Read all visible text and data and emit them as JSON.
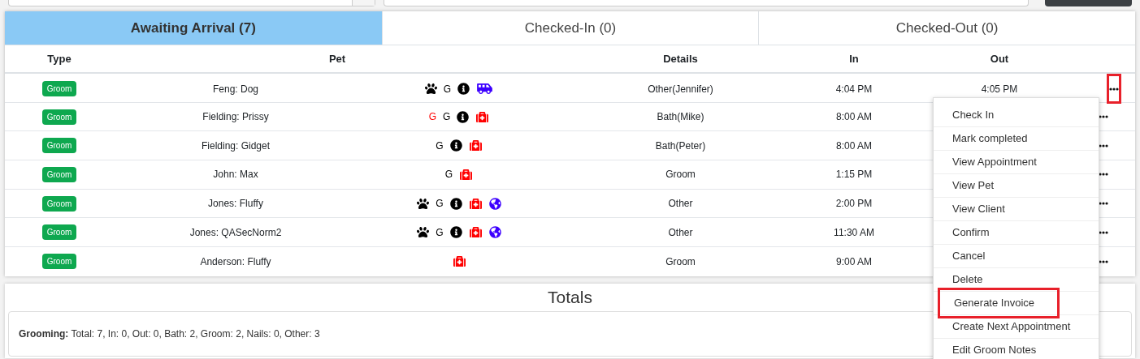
{
  "tabs": [
    {
      "label": "Awaiting Arrival (7)",
      "selected": true
    },
    {
      "label": "Checked-In (0)",
      "selected": false
    },
    {
      "label": "Checked-Out (0)",
      "selected": false
    }
  ],
  "table": {
    "columns": [
      "Type",
      "Pet",
      "Details",
      "In",
      "Out"
    ],
    "rows": [
      {
        "type": "Groom",
        "pet": "Feng: Dog",
        "flags": [
          {
            "kind": "paw"
          },
          {
            "kind": "letter",
            "text": "G",
            "color": "#000000"
          },
          {
            "kind": "info"
          },
          {
            "kind": "van"
          }
        ],
        "details": "Other(Jennifer)",
        "in": "4:04 PM",
        "out": "4:05 PM",
        "actions_highlighted": true
      },
      {
        "type": "Groom",
        "pet": "Fielding: Prissy",
        "flags": [
          {
            "kind": "letter",
            "text": "G",
            "color": "#ff0000"
          },
          {
            "kind": "letter",
            "text": "G",
            "color": "#000000"
          },
          {
            "kind": "info"
          },
          {
            "kind": "medkit"
          }
        ],
        "details": "Bath(Mike)",
        "in": "8:00 AM",
        "out": "",
        "actions_highlighted": false
      },
      {
        "type": "Groom",
        "pet": "Fielding: Gidget",
        "flags": [
          {
            "kind": "letter",
            "text": "G",
            "color": "#000000"
          },
          {
            "kind": "info"
          },
          {
            "kind": "medkit"
          }
        ],
        "details": "Bath(Peter)",
        "in": "8:00 AM",
        "actions_highlighted": false
      },
      {
        "type": "Groom",
        "pet": "John: Max",
        "flags": [
          {
            "kind": "letter",
            "text": "G",
            "color": "#000000"
          },
          {
            "kind": "medkit"
          }
        ],
        "details": "Groom",
        "in": "1:15 PM",
        "actions_highlighted": false
      },
      {
        "type": "Groom",
        "pet": "Jones: Fluffy",
        "flags": [
          {
            "kind": "paw"
          },
          {
            "kind": "letter",
            "text": "G",
            "color": "#000000"
          },
          {
            "kind": "info"
          },
          {
            "kind": "medkit"
          },
          {
            "kind": "globe"
          }
        ],
        "details": "Other",
        "in": "2:00 PM",
        "actions_highlighted": false
      },
      {
        "type": "Groom",
        "pet": "Jones: QASecNorm2",
        "flags": [
          {
            "kind": "paw"
          },
          {
            "kind": "letter",
            "text": "G",
            "color": "#000000"
          },
          {
            "kind": "info"
          },
          {
            "kind": "medkit"
          },
          {
            "kind": "globe"
          }
        ],
        "details": "Other",
        "in": "11:30 AM",
        "actions_highlighted": false
      },
      {
        "type": "Groom",
        "pet": "Anderson: Fluffy",
        "flags": [
          {
            "kind": "medkit"
          }
        ],
        "details": "Groom",
        "in": "9:00 AM",
        "actions_highlighted": false
      }
    ]
  },
  "menu": {
    "items": [
      {
        "label": "Check In",
        "highlighted": false
      },
      {
        "label": "Mark completed",
        "highlighted": false
      },
      {
        "label": "View Appointment",
        "highlighted": false
      },
      {
        "label": "View Pet",
        "highlighted": false
      },
      {
        "label": "View Client",
        "highlighted": false
      },
      {
        "label": "Confirm",
        "highlighted": false
      },
      {
        "label": "Cancel",
        "highlighted": false
      },
      {
        "label": "Delete",
        "highlighted": false
      },
      {
        "label": "Generate Invoice",
        "highlighted": true
      },
      {
        "label": "Create Next Appointment",
        "highlighted": false
      },
      {
        "label": "Edit Groom Notes",
        "highlighted": false
      }
    ]
  },
  "totals": {
    "title": "Totals",
    "summary": "**Grooming:** Total: 7, In: 0, Out: 0, Bath: 2, Groom: 2, Nails: 0, Other: 3"
  }
}
